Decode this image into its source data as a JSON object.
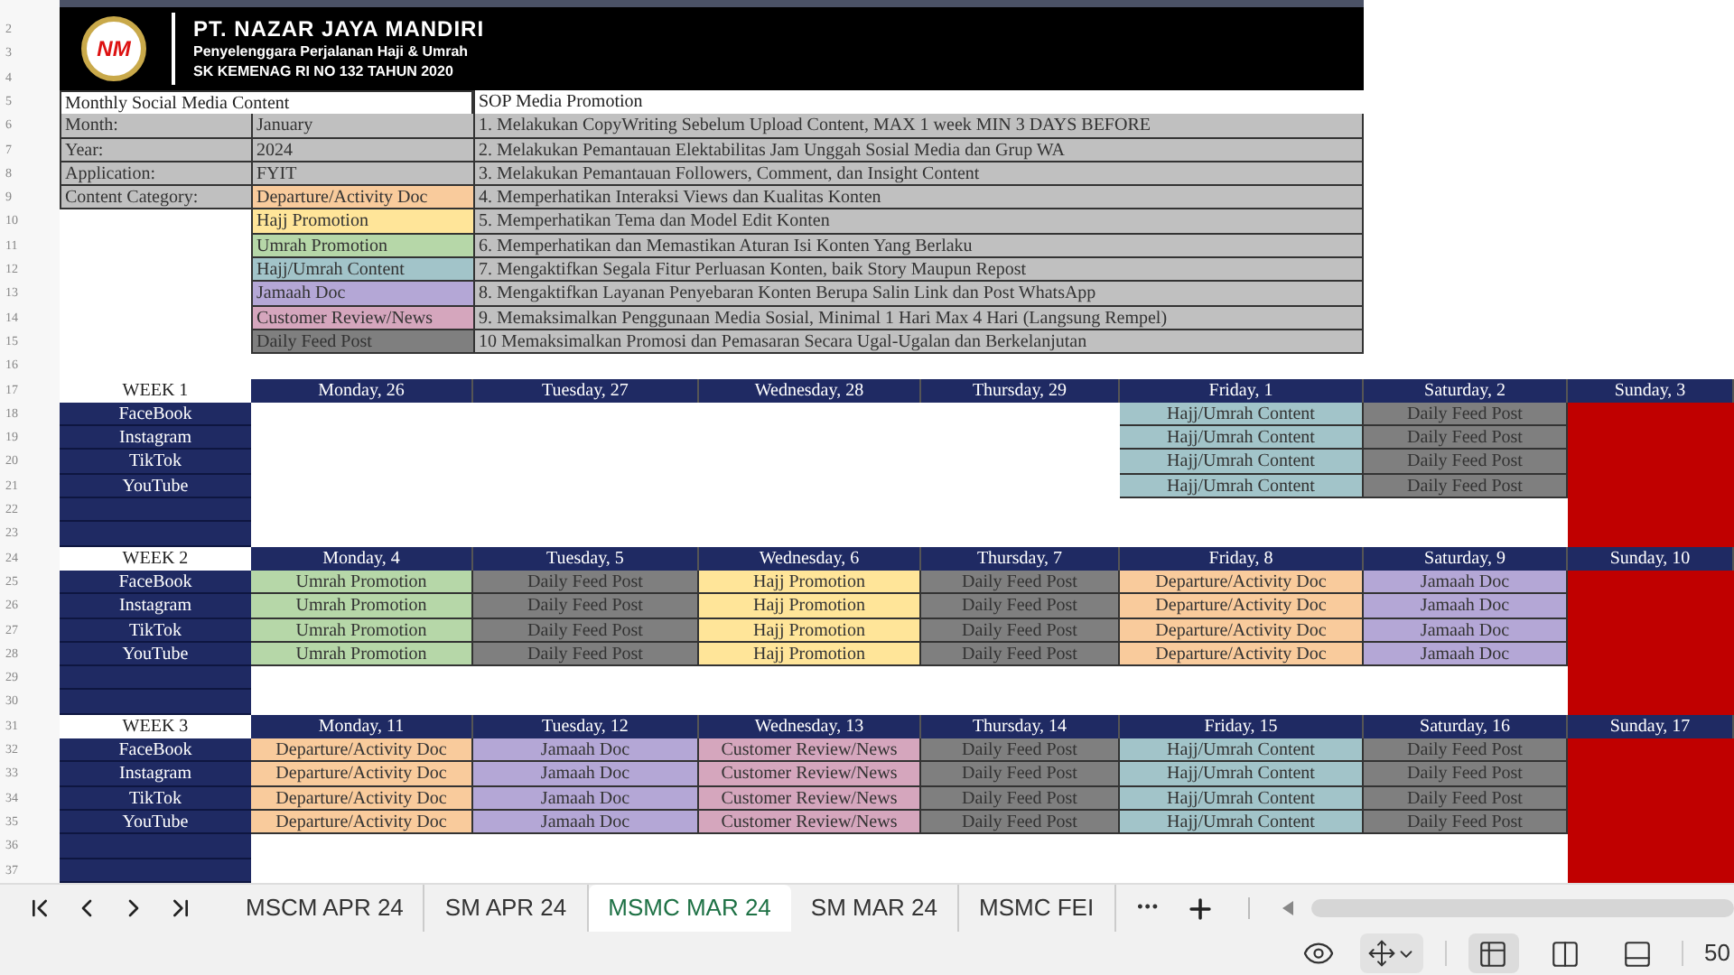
{
  "header": {
    "logo_text": "NM",
    "company": "PT. NAZAR JAYA MANDIRI",
    "tagline": "Penyelenggara Perjalanan Haji & Umrah",
    "license": "SK KEMENAG RI NO 132 TAHUN 2020"
  },
  "row_numbers": [
    "2",
    "3",
    "4",
    "5",
    "6",
    "7",
    "8",
    "9",
    "10",
    "11",
    "12",
    "13",
    "14",
    "15",
    "16",
    "17",
    "18",
    "19",
    "20",
    "21",
    "22",
    "23",
    "24",
    "25",
    "26",
    "27",
    "28",
    "29",
    "30",
    "31",
    "32",
    "33",
    "34",
    "35",
    "36",
    "37"
  ],
  "info": {
    "title": "Monthly Social Media Content",
    "sop_title": "SOP Media Promotion",
    "fields": [
      {
        "label": "Month:",
        "value": "January"
      },
      {
        "label": "Year:",
        "value": "2024"
      },
      {
        "label": "Application:",
        "value": "FYIT"
      }
    ],
    "category_label": "Content Category:",
    "categories": [
      {
        "name": "Departure/Activity Doc",
        "color": "#f9cb9c"
      },
      {
        "name": "Hajj Promotion",
        "color": "#ffe599"
      },
      {
        "name": "Umrah Promotion",
        "color": "#b6d7a8"
      },
      {
        "name": "Hajj/Umrah Content",
        "color": "#a2c4c9"
      },
      {
        "name": "Jamaah Doc",
        "color": "#b4a7d6"
      },
      {
        "name": "Customer Review/News",
        "color": "#d5a6bd"
      },
      {
        "name": "Daily Feed Post",
        "color": "#7f7f7f"
      }
    ],
    "sop": [
      "1. Melakukan CopyWriting Sebelum Upload Content, MAX 1 week MIN 3 DAYS BEFORE",
      "2. Melakukan Pemantauan Elektabilitas Jam Unggah Sosial Media dan Grup WA",
      "3. Melakukan Pemantauan Followers, Comment, dan Insight Content",
      "4. Memperhatikan Interaksi Views dan Kualitas Konten",
      "5. Memperhatikan Tema dan Model Edit Konten",
      "6. Memperhatikan dan Memastikan Aturan Isi Konten Yang Berlaku",
      "7. Mengaktifkan Segala Fitur Perluasan Konten, baik Story Maupun Repost",
      "8. Mengaktifkan Layanan Penyebaran Konten Berupa Salin Link dan Post WhatsApp",
      "9. Memaksimalkan Penggunaan Media Sosial, Minimal 1 Hari Max 4 Hari (Langsung Rempel)",
      "10 Memaksimalkan Promosi dan Pemasaran Secara Ugal-Ugalan dan Berkelanjutan"
    ]
  },
  "weeks": [
    {
      "label": "WEEK 1",
      "days": [
        "Monday, 26",
        "Tuesday, 27",
        "Wednesday, 28",
        "Thursday, 29",
        "Friday, 1",
        "Saturday, 2",
        "Sunday, 3"
      ],
      "rows": [
        {
          "platform": "FaceBook",
          "cells": [
            {
              "kind": "empty"
            },
            {
              "kind": "empty"
            },
            {
              "kind": "empty"
            },
            {
              "kind": "empty"
            },
            {
              "kind": "post",
              "text": "Hajj/Umrah Content",
              "color": "#a2c4c9"
            },
            {
              "kind": "post",
              "text": "Daily Feed Post",
              "color": "#7f7f7f"
            },
            {
              "kind": "off"
            }
          ]
        },
        {
          "platform": "Instagram",
          "cells": [
            {
              "kind": "empty"
            },
            {
              "kind": "empty"
            },
            {
              "kind": "empty"
            },
            {
              "kind": "empty"
            },
            {
              "kind": "post",
              "text": "Hajj/Umrah Content",
              "color": "#a2c4c9"
            },
            {
              "kind": "post",
              "text": "Daily Feed Post",
              "color": "#7f7f7f"
            },
            {
              "kind": "off"
            }
          ]
        },
        {
          "platform": "TikTok",
          "cells": [
            {
              "kind": "empty"
            },
            {
              "kind": "empty"
            },
            {
              "kind": "empty"
            },
            {
              "kind": "empty"
            },
            {
              "kind": "post",
              "text": "Hajj/Umrah Content",
              "color": "#a2c4c9"
            },
            {
              "kind": "post",
              "text": "Daily Feed Post",
              "color": "#7f7f7f"
            },
            {
              "kind": "off"
            }
          ]
        },
        {
          "platform": "YouTube",
          "cells": [
            {
              "kind": "empty"
            },
            {
              "kind": "empty"
            },
            {
              "kind": "empty"
            },
            {
              "kind": "empty"
            },
            {
              "kind": "post",
              "text": "Hajj/Umrah Content",
              "color": "#a2c4c9"
            },
            {
              "kind": "post",
              "text": "Daily Feed Post",
              "color": "#7f7f7f"
            },
            {
              "kind": "off"
            }
          ]
        },
        {
          "cells": [
            {
              "kind": "empty"
            },
            {
              "kind": "empty"
            },
            {
              "kind": "empty"
            },
            {
              "kind": "empty"
            },
            {
              "kind": "empty"
            },
            {
              "kind": "empty"
            },
            {
              "kind": "off"
            }
          ]
        },
        {
          "cells": [
            {
              "kind": "empty"
            },
            {
              "kind": "empty"
            },
            {
              "kind": "empty"
            },
            {
              "kind": "empty"
            },
            {
              "kind": "empty"
            },
            {
              "kind": "empty"
            },
            {
              "kind": "off"
            }
          ]
        }
      ]
    },
    {
      "label": "WEEK 2",
      "days": [
        "Monday, 4",
        "Tuesday, 5",
        "Wednesday, 6",
        "Thursday, 7",
        "Friday, 8",
        "Saturday, 9",
        "Sunday, 10"
      ],
      "rows": [
        {
          "platform": "FaceBook",
          "cells": [
            {
              "kind": "post",
              "text": "Umrah Promotion",
              "color": "#b6d7a8"
            },
            {
              "kind": "post",
              "text": "Daily Feed Post",
              "color": "#7f7f7f"
            },
            {
              "kind": "post",
              "text": "Hajj Promotion",
              "color": "#ffe599"
            },
            {
              "kind": "post",
              "text": "Daily Feed Post",
              "color": "#7f7f7f"
            },
            {
              "kind": "post",
              "text": "Departure/Activity Doc",
              "color": "#f9cb9c"
            },
            {
              "kind": "post",
              "text": "Jamaah Doc",
              "color": "#b4a7d6"
            },
            {
              "kind": "off"
            }
          ]
        },
        {
          "platform": "Instagram",
          "cells": [
            {
              "kind": "post",
              "text": "Umrah Promotion",
              "color": "#b6d7a8"
            },
            {
              "kind": "post",
              "text": "Daily Feed Post",
              "color": "#7f7f7f"
            },
            {
              "kind": "post",
              "text": "Hajj Promotion",
              "color": "#ffe599"
            },
            {
              "kind": "post",
              "text": "Daily Feed Post",
              "color": "#7f7f7f"
            },
            {
              "kind": "post",
              "text": "Departure/Activity Doc",
              "color": "#f9cb9c"
            },
            {
              "kind": "post",
              "text": "Jamaah Doc",
              "color": "#b4a7d6"
            },
            {
              "kind": "off"
            }
          ]
        },
        {
          "platform": "TikTok",
          "cells": [
            {
              "kind": "post",
              "text": "Umrah Promotion",
              "color": "#b6d7a8"
            },
            {
              "kind": "post",
              "text": "Daily Feed Post",
              "color": "#7f7f7f"
            },
            {
              "kind": "post",
              "text": "Hajj Promotion",
              "color": "#ffe599"
            },
            {
              "kind": "post",
              "text": "Daily Feed Post",
              "color": "#7f7f7f"
            },
            {
              "kind": "post",
              "text": "Departure/Activity Doc",
              "color": "#f9cb9c"
            },
            {
              "kind": "post",
              "text": "Jamaah Doc",
              "color": "#b4a7d6"
            },
            {
              "kind": "off"
            }
          ]
        },
        {
          "platform": "YouTube",
          "cells": [
            {
              "kind": "post",
              "text": "Umrah Promotion",
              "color": "#b6d7a8"
            },
            {
              "kind": "post",
              "text": "Daily Feed Post",
              "color": "#7f7f7f"
            },
            {
              "kind": "post",
              "text": "Hajj Promotion",
              "color": "#ffe599"
            },
            {
              "kind": "post",
              "text": "Daily Feed Post",
              "color": "#7f7f7f"
            },
            {
              "kind": "post",
              "text": "Departure/Activity Doc",
              "color": "#f9cb9c"
            },
            {
              "kind": "post",
              "text": "Jamaah Doc",
              "color": "#b4a7d6"
            },
            {
              "kind": "off"
            }
          ]
        },
        {
          "cells": [
            {
              "kind": "empty"
            },
            {
              "kind": "empty"
            },
            {
              "kind": "empty"
            },
            {
              "kind": "empty"
            },
            {
              "kind": "empty"
            },
            {
              "kind": "empty"
            },
            {
              "kind": "off"
            }
          ]
        },
        {
          "cells": [
            {
              "kind": "empty"
            },
            {
              "kind": "empty"
            },
            {
              "kind": "empty"
            },
            {
              "kind": "empty"
            },
            {
              "kind": "empty"
            },
            {
              "kind": "empty"
            },
            {
              "kind": "off"
            }
          ]
        }
      ]
    },
    {
      "label": "WEEK 3",
      "days": [
        "Monday, 11",
        "Tuesday, 12",
        "Wednesday, 13",
        "Thursday, 14",
        "Friday, 15",
        "Saturday, 16",
        "Sunday, 17"
      ],
      "rows": [
        {
          "platform": "FaceBook",
          "cells": [
            {
              "kind": "post",
              "text": "Departure/Activity Doc",
              "color": "#f9cb9c"
            },
            {
              "kind": "post",
              "text": "Jamaah Doc",
              "color": "#b4a7d6"
            },
            {
              "kind": "post",
              "text": "Customer Review/News",
              "color": "#d5a6bd"
            },
            {
              "kind": "post",
              "text": "Daily Feed Post",
              "color": "#7f7f7f"
            },
            {
              "kind": "post",
              "text": "Hajj/Umrah Content",
              "color": "#a2c4c9"
            },
            {
              "kind": "post",
              "text": "Daily Feed Post",
              "color": "#7f7f7f"
            },
            {
              "kind": "off"
            }
          ]
        },
        {
          "platform": "Instagram",
          "cells": [
            {
              "kind": "post",
              "text": "Departure/Activity Doc",
              "color": "#f9cb9c"
            },
            {
              "kind": "post",
              "text": "Jamaah Doc",
              "color": "#b4a7d6"
            },
            {
              "kind": "post",
              "text": "Customer Review/News",
              "color": "#d5a6bd"
            },
            {
              "kind": "post",
              "text": "Daily Feed Post",
              "color": "#7f7f7f"
            },
            {
              "kind": "post",
              "text": "Hajj/Umrah Content",
              "color": "#a2c4c9"
            },
            {
              "kind": "post",
              "text": "Daily Feed Post",
              "color": "#7f7f7f"
            },
            {
              "kind": "off"
            }
          ]
        },
        {
          "platform": "TikTok",
          "cells": [
            {
              "kind": "post",
              "text": "Departure/Activity Doc",
              "color": "#f9cb9c"
            },
            {
              "kind": "post",
              "text": "Jamaah Doc",
              "color": "#b4a7d6"
            },
            {
              "kind": "post",
              "text": "Customer Review/News",
              "color": "#d5a6bd"
            },
            {
              "kind": "post",
              "text": "Daily Feed Post",
              "color": "#7f7f7f"
            },
            {
              "kind": "post",
              "text": "Hajj/Umrah Content",
              "color": "#a2c4c9"
            },
            {
              "kind": "post",
              "text": "Daily Feed Post",
              "color": "#7f7f7f"
            },
            {
              "kind": "off"
            }
          ]
        },
        {
          "platform": "YouTube",
          "cells": [
            {
              "kind": "post",
              "text": "Departure/Activity Doc",
              "color": "#f9cb9c"
            },
            {
              "kind": "post",
              "text": "Jamaah Doc",
              "color": "#b4a7d6"
            },
            {
              "kind": "post",
              "text": "Customer Review/News",
              "color": "#d5a6bd"
            },
            {
              "kind": "post",
              "text": "Daily Feed Post",
              "color": "#7f7f7f"
            },
            {
              "kind": "post",
              "text": "Hajj/Umrah Content",
              "color": "#a2c4c9"
            },
            {
              "kind": "post",
              "text": "Daily Feed Post",
              "color": "#7f7f7f"
            },
            {
              "kind": "off"
            }
          ]
        },
        {
          "cells": [
            {
              "kind": "empty"
            },
            {
              "kind": "empty"
            },
            {
              "kind": "empty"
            },
            {
              "kind": "empty"
            },
            {
              "kind": "empty"
            },
            {
              "kind": "empty"
            },
            {
              "kind": "off"
            }
          ]
        },
        {
          "cells": [
            {
              "kind": "empty"
            },
            {
              "kind": "empty"
            },
            {
              "kind": "empty"
            },
            {
              "kind": "empty"
            },
            {
              "kind": "empty"
            },
            {
              "kind": "empty"
            },
            {
              "kind": "off"
            }
          ]
        }
      ]
    }
  ],
  "sheet_tabs": [
    {
      "label": "MSCM APR 24",
      "selected": false
    },
    {
      "label": "SM APR 24",
      "selected": false
    },
    {
      "label": "MSMC MAR 24",
      "selected": true
    },
    {
      "label": "SM MAR 24",
      "selected": false
    },
    {
      "label": "MSMC FEI",
      "selected": false
    }
  ],
  "more_tabs": "•••",
  "views": [
    {
      "kind": "normal",
      "selected": true
    },
    {
      "kind": "split",
      "selected": false
    },
    {
      "kind": "page",
      "selected": false
    }
  ],
  "zoom": "50"
}
